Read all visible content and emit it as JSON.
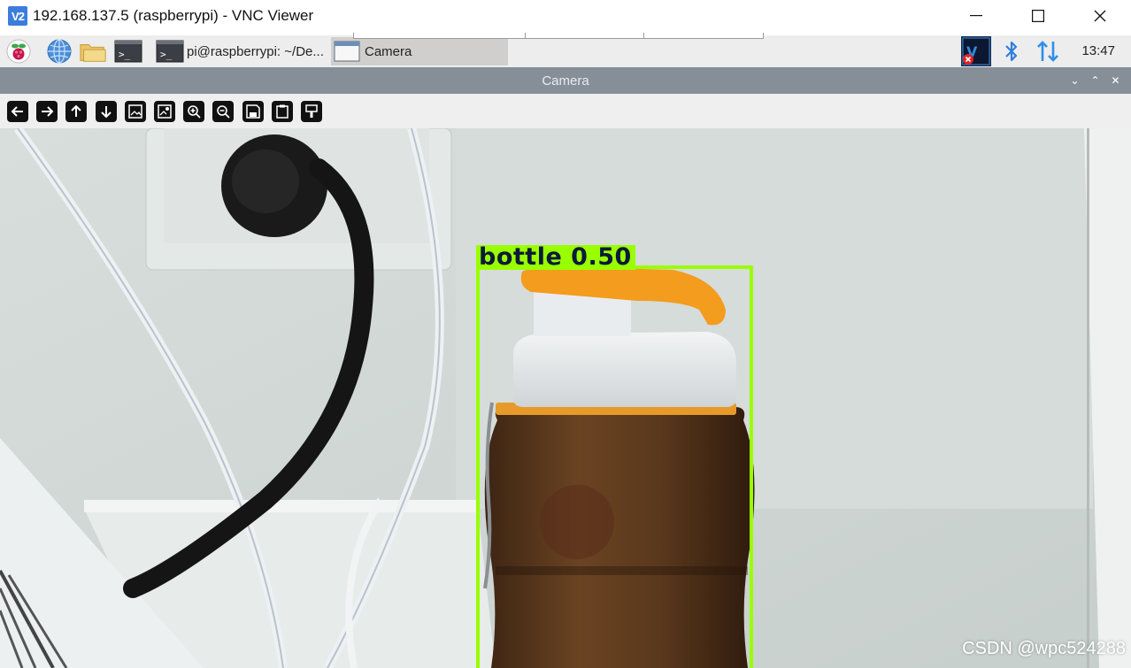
{
  "window": {
    "title": "192.168.137.5 (raspberrypi) - VNC Viewer",
    "logo_text": "V2",
    "minimize_symbol": "—",
    "maximize_symbol": "☐",
    "close_symbol": "✕"
  },
  "panel": {
    "taskbar": [
      {
        "label": "pi@raspberrypi: ~/De...",
        "icon": "terminal-icon"
      },
      {
        "label": "Camera",
        "icon": "window-icon",
        "active": true
      }
    ],
    "clock": "13:47",
    "icons": [
      "raspberry-menu-icon",
      "web-browser-icon",
      "file-manager-icon",
      "terminal-icon",
      "vnc-server-icon",
      "bluetooth-icon",
      "network-icon"
    ]
  },
  "camera_window": {
    "title": "Camera",
    "controls": {
      "minimize": "⌄",
      "maximize": "⌃",
      "close": "✕"
    },
    "toolbar": [
      "back-arrow-icon",
      "forward-arrow-icon",
      "up-arrow-icon",
      "down-arrow-icon",
      "image-icon",
      "image-settings-icon",
      "zoom-in-icon",
      "zoom-out-icon",
      "save-icon",
      "clipboard-icon",
      "brush-icon"
    ]
  },
  "detection": {
    "label": "bottle 0.50",
    "box_color": "#99ff00"
  },
  "watermark": "CSDN @wpc524288"
}
